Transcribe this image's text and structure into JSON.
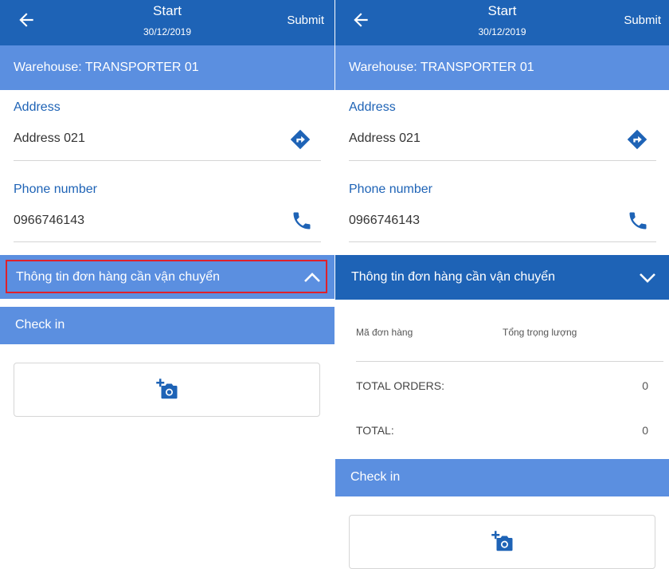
{
  "screens": [
    {
      "header": {
        "title": "Start",
        "date": "30/12/2019",
        "submit_label": "Submit"
      },
      "warehouse_label": "Warehouse: TRANSPORTER 01",
      "address": {
        "label": "Address",
        "value": "Address 021"
      },
      "phone": {
        "label": "Phone number",
        "value": "0966746143"
      },
      "order_section": {
        "title": "Thông tin đơn hàng cần vận chuyển",
        "state": "collapsed"
      },
      "checkin_label": "Check in"
    },
    {
      "header": {
        "title": "Start",
        "date": "30/12/2019",
        "submit_label": "Submit"
      },
      "warehouse_label": "Warehouse: TRANSPORTER 01",
      "address": {
        "label": "Address",
        "value": "Address 021"
      },
      "phone": {
        "label": "Phone number",
        "value": "0966746143"
      },
      "order_section": {
        "title": "Thông tin đơn hàng cần vận chuyển",
        "state": "expanded",
        "columns": [
          "Mã đơn hàng",
          "Tổng trọng lượng"
        ],
        "total_orders_label": "TOTAL ORDERS:",
        "total_orders_value": "0",
        "total_label": "TOTAL:",
        "total_value": "0"
      },
      "checkin_label": "Check in"
    }
  ],
  "colors": {
    "primary": "#1e63b6",
    "light_blue": "#5b8fe0",
    "highlight_border": "#e0202a"
  },
  "icons": {
    "back": "arrow-left-icon",
    "directions": "directions-icon",
    "phone": "phone-icon",
    "chevron_up": "chevron-up-icon",
    "chevron_down": "chevron-down-icon",
    "camera": "add-photo-icon"
  }
}
